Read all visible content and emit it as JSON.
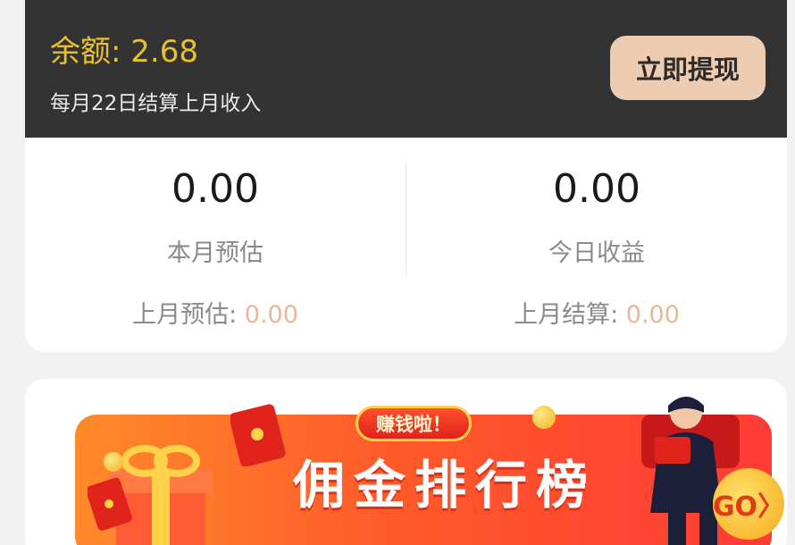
{
  "balance": {
    "label": "余额: 2.68",
    "note": "每月22日结算上月收入",
    "withdraw_label": "立即提现"
  },
  "stats": {
    "left": {
      "value": "0.00",
      "label": "本月预估",
      "sub_label": "上月预估: ",
      "sub_value": "0.00"
    },
    "right": {
      "value": "0.00",
      "label": "今日收益",
      "sub_label": "上月结算: ",
      "sub_value": "0.00"
    }
  },
  "banner": {
    "tag": "赚钱啦！",
    "title": "佣金排行榜",
    "go_label": "GO〉"
  },
  "colors": {
    "balance_yellow": "#e8c12e",
    "header_dark": "#333333",
    "withdraw_bg": "#eccdb4",
    "muted_value": "#e6b899",
    "banner_red": "#ff3b35"
  },
  "icons": [
    "gift-icon",
    "red-envelope-icon",
    "coin-icon",
    "person-illustration",
    "go-arrow-icon"
  ]
}
